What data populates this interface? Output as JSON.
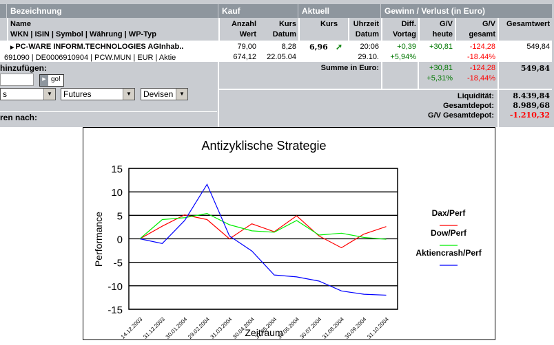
{
  "table": {
    "groups": {
      "bezeichnung": "Bezeichnung",
      "kauf": "Kauf",
      "aktuell": "Aktuell",
      "gv": "Gewinn / Verlust  (in Euro)"
    },
    "columns": {
      "name": "Name",
      "ids": "WKN | ISIN | Symbol | Währung | WP-Typ",
      "anzahl": "Anzahl",
      "wert": "Wert",
      "kurs_kauf": "Kurs",
      "datum_kauf": "Datum",
      "kurs": "Kurs",
      "uhrzeit": "Uhrzeit",
      "datum": "Datum",
      "diff": "Diff.",
      "vortag": "Vortag",
      "gv1": "G/V",
      "heute": "heute",
      "gv2": "G/V",
      "gesamt": "gesamt",
      "gesamtwert": "Gesamtwert"
    },
    "row": {
      "name": "PC-WARE INFORM.TECHNOLOGIES AGInhab..",
      "ids": "691090 | DE0006910904 | PCW.MUN | EUR | Aktie",
      "anzahl": "79,00",
      "wert": "674,12",
      "kurs_kauf": "8,28",
      "datum_kauf": "22.05.04",
      "kurs": "6,96",
      "uhrzeit": "20:06",
      "datum": "29.10.",
      "diff": "+0,39",
      "diff_pct": "+5,94%",
      "gv_heute": "+30,81",
      "gv_gesamt": "-124,28",
      "gv_gesamt_pct": "-18.44%",
      "gesamtwert": "549,84"
    },
    "summe": {
      "label": "Summe in Euro:",
      "heute": "+30,81",
      "heute_pct": "+5,31%",
      "gesamt": "-124,28",
      "gesamt_pct": "-18,44%",
      "gesamtwert": "549,84"
    },
    "totals": [
      {
        "label": "Liquidität:",
        "value": "8.439,84"
      },
      {
        "label": "Gesamtdepot:",
        "value": "8.989,68"
      },
      {
        "label": "G/V Gesamtdepot:",
        "value": "-1.210,32"
      }
    ]
  },
  "left_panel": {
    "add_label": "hinzufügen:",
    "go": "go!",
    "select1": "s",
    "select2": "Futures",
    "select3": "Devisen",
    "sort_label": "ren nach:"
  },
  "colors": {
    "up": "#007700",
    "down": "#ff0000",
    "header": "#8e969e"
  },
  "chart_data": {
    "type": "line",
    "title": "Antizyklische Strategie",
    "xlabel": "Zeitraum",
    "ylabel": "Performance",
    "ylim": [
      -15,
      15
    ],
    "yticks": [
      15,
      10,
      5,
      0,
      -5,
      -10,
      -15
    ],
    "grid": true,
    "legend": "right",
    "categories": [
      "14.12.2003",
      "31.12.2003",
      "30.01.2004",
      "29.02.2004",
      "31.03.2004",
      "30.04.2004",
      "31.05.2004",
      "30.06.2004",
      "30.07.2004",
      "31.08.2004",
      "30.09.2004",
      "31.10.2004"
    ],
    "series": [
      {
        "name": "Dax/Perf",
        "color": "#ff0000",
        "values": [
          0,
          2.7,
          5.1,
          4.1,
          0,
          3.2,
          1.5,
          4.9,
          0.6,
          -1.9,
          1.0,
          2.6
        ]
      },
      {
        "name": "Dow/Perf",
        "color": "#00ee00",
        "values": [
          0,
          4.1,
          4.5,
          5.4,
          3.0,
          1.7,
          1.4,
          3.9,
          0.8,
          1.2,
          0.3,
          -0.1
        ]
      },
      {
        "name": "Aktiencrash/Perf",
        "color": "#0000ff",
        "values": [
          0,
          -1.0,
          3.9,
          11.6,
          0.6,
          -2.6,
          -7.7,
          -8.1,
          -9.0,
          -11.1,
          -11.8,
          -12.0
        ]
      }
    ]
  }
}
